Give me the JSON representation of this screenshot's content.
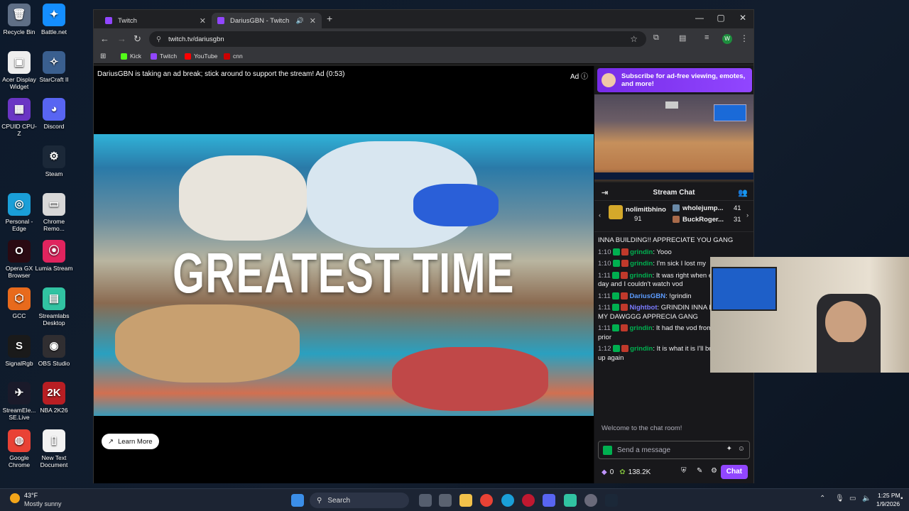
{
  "desktop": {
    "icons": [
      {
        "label": "Recycle Bin",
        "glyph": "🗑",
        "color": "#5f6f86"
      },
      {
        "label": "Battle.net",
        "glyph": "✦",
        "color": "#148eff"
      },
      {
        "label": "Acer Display Widget",
        "glyph": "▣",
        "color": "#eeeeee"
      },
      {
        "label": "StarCraft II",
        "glyph": "✧",
        "color": "#3a5f8f"
      },
      {
        "label": "CPUID CPU-Z",
        "glyph": "▦",
        "color": "#6a35c4"
      },
      {
        "label": "Discord",
        "glyph": "◕",
        "color": "#5865f2"
      },
      {
        "label": "Steam",
        "glyph": "⚙",
        "color": "#1b2838"
      },
      {
        "label": "Personal - Edge",
        "glyph": "◎",
        "color": "#1a9fd8"
      },
      {
        "label": "Chrome Remo...",
        "glyph": "▭",
        "color": "#d8d8d8"
      },
      {
        "label": "Opera GX Browser",
        "glyph": "O",
        "color": "#2a0a12"
      },
      {
        "label": "Lumia Stream",
        "glyph": "⦿",
        "color": "#e0245e"
      },
      {
        "label": "GCC",
        "glyph": "⬡",
        "color": "#e86a1c"
      },
      {
        "label": "Streamlabs Desktop",
        "glyph": "▤",
        "color": "#31c3a2"
      },
      {
        "label": "SignalRgb",
        "glyph": "S",
        "color": "#1a1a1a"
      },
      {
        "label": "OBS Studio",
        "glyph": "◉",
        "color": "#302e31"
      },
      {
        "label": "StreamEle... SE.Live",
        "glyph": "✈",
        "color": "#1a1a2a"
      },
      {
        "label": "NBA 2K26",
        "glyph": "2K",
        "color": "#b81e23"
      },
      {
        "label": "Google Chrome",
        "glyph": "◍",
        "color": "#e94235"
      },
      {
        "label": "New Text Document",
        "glyph": "▯",
        "color": "#f2f2f2"
      }
    ]
  },
  "browser": {
    "tabs": [
      {
        "title": "Twitch"
      },
      {
        "title": "DariusGBN - Twitch"
      }
    ],
    "new_tab": "+",
    "url": "twitch.tv/dariusgbn",
    "bookmarks": [
      "Kick",
      "Twitch",
      "YouTube",
      "cnn"
    ],
    "profile_initial": "W"
  },
  "player": {
    "ad_message": "DariusGBN is taking an ad break; stick around to support the stream! Ad (0:53)",
    "ad_label": "Ad",
    "overlay_text": "GREATEST TIME",
    "learn_more": "Learn More"
  },
  "sidebar": {
    "sub_banner": "Subscribe for ad-free viewing, emotes, and more!",
    "chat_title": "Stream Chat",
    "leaderboard": [
      {
        "name": "nolimitbhino",
        "value": "91"
      },
      {
        "name": "wholejump...",
        "value": "41"
      },
      {
        "name": "BuckRoger...",
        "value": "31"
      }
    ],
    "messages": [
      {
        "time": "",
        "user": "",
        "text": "INNA BUILDING!! APPRECIATE YOU GANG",
        "user_color": "#efeff1"
      },
      {
        "time": "1:10",
        "user": "grindin",
        "text": ": Yooo",
        "user_color": "#00b050"
      },
      {
        "time": "1:10",
        "user": "grindin",
        "text": ": I'm sick I lost my",
        "user_color": "#00b050"
      },
      {
        "time": "1:11",
        "user": "grindin",
        "text": ": It was right when ended one day and I couldn't watch vod",
        "user_color": "#00b050"
      },
      {
        "time": "1:11",
        "user": "DariusGBN",
        "text": ": !grindin",
        "user_color": "#5c9cff"
      },
      {
        "time": "1:11",
        "user": "Nightbot",
        "text": ": GRINDIN INNA BUILDING!! MY DAWGGG APPRECIA GANG",
        "user_color": "#7b7bff"
      },
      {
        "time": "1:11",
        "user": "grindin",
        "text": ": It had the vod from two days prior",
        "user_color": "#00b050"
      },
      {
        "time": "1:12",
        "user": "grindin",
        "text": ": It is what it is I'll build it back up again",
        "user_color": "#00b050"
      }
    ],
    "welcome": "Welcome to the chat room!",
    "input_placeholder": "Send a message",
    "points": "0",
    "channel_points": "138.2K",
    "chat_button": "Chat"
  },
  "taskbar": {
    "weather_temp": "43°F",
    "weather_desc": "Mostly sunny",
    "search": "Search",
    "time": "1:25 PM",
    "date": "1/9/2026"
  }
}
